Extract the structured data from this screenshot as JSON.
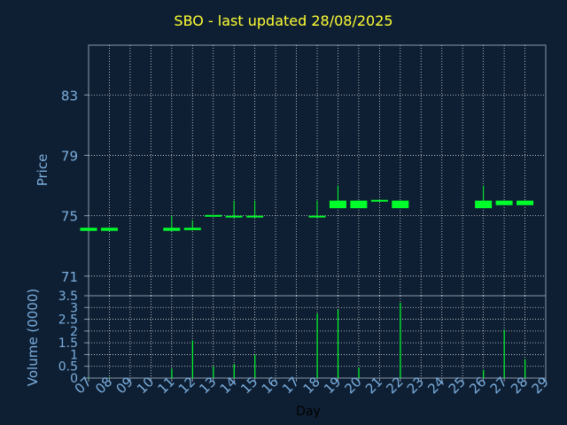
{
  "title": "SBO - last updated 28/08/2025",
  "colors": {
    "background": "#0f1f33",
    "title": "#ffff33",
    "axis_text": "#7aaede",
    "grid": "#ffffff",
    "candle": "#00ff2a",
    "xlabel": "#000000"
  },
  "chart_data": [
    {
      "type": "candlestick",
      "ylabel": "Price",
      "ylim": [
        69.7,
        86.3
      ],
      "yticks": [
        71,
        75,
        79,
        83
      ],
      "grid": true,
      "candles": [
        {
          "day": 7,
          "open": 74.2,
          "close": 74.0,
          "high": 74.2,
          "low": 74.0
        },
        {
          "day": 8,
          "open": 74.2,
          "close": 74.0,
          "high": 74.2,
          "low": 74.0
        },
        {
          "day": 11,
          "open": 74.2,
          "close": 74.0,
          "high": 75.0,
          "low": 74.0
        },
        {
          "day": 12,
          "open": 74.2,
          "close": 74.05,
          "high": 74.7,
          "low": 74.05
        },
        {
          "day": 13,
          "open": 75.05,
          "close": 74.95,
          "high": 75.05,
          "low": 74.95
        },
        {
          "day": 14,
          "open": 75.0,
          "close": 74.9,
          "high": 76.0,
          "low": 74.9
        },
        {
          "day": 15,
          "open": 75.0,
          "close": 74.9,
          "high": 76.0,
          "low": 74.9
        },
        {
          "day": 18,
          "open": 75.0,
          "close": 74.9,
          "high": 76.0,
          "low": 74.9
        },
        {
          "day": 19,
          "open": 76.0,
          "close": 75.5,
          "high": 77.0,
          "low": 75.5
        },
        {
          "day": 20,
          "open": 76.0,
          "close": 75.5,
          "high": 76.0,
          "low": 75.5
        },
        {
          "day": 21,
          "open": 76.05,
          "close": 75.95,
          "high": 76.05,
          "low": 75.95
        },
        {
          "day": 22,
          "open": 76.0,
          "close": 75.5,
          "high": 76.0,
          "low": 75.5
        },
        {
          "day": 26,
          "open": 76.0,
          "close": 75.5,
          "high": 77.0,
          "low": 75.5
        },
        {
          "day": 27,
          "open": 76.0,
          "close": 75.7,
          "high": 76.0,
          "low": 75.7
        },
        {
          "day": 28,
          "open": 76.0,
          "close": 75.7,
          "high": 76.0,
          "low": 75.7
        }
      ]
    },
    {
      "type": "bar",
      "ylabel": "Volume (0000)",
      "xlabel": "Day",
      "ylim": [
        0,
        3.5
      ],
      "yticks": [
        0,
        0.5,
        1,
        1.5,
        2,
        2.5,
        3,
        3.5
      ],
      "grid": true,
      "x": [
        7,
        8,
        11,
        12,
        13,
        14,
        15,
        18,
        19,
        20,
        22,
        26,
        27,
        28
      ],
      "values": [
        0.03,
        0.03,
        0.4,
        1.6,
        0.5,
        0.6,
        1.0,
        2.75,
        2.9,
        0.45,
        3.2,
        0.35,
        2.05,
        0.8
      ],
      "xticks": [
        "07",
        "08",
        "09",
        "10",
        "11",
        "12",
        "13",
        "14",
        "15",
        "16",
        "17",
        "18",
        "19",
        "20",
        "21",
        "22",
        "23",
        "24",
        "25",
        "26",
        "27",
        "28",
        "29"
      ]
    }
  ]
}
